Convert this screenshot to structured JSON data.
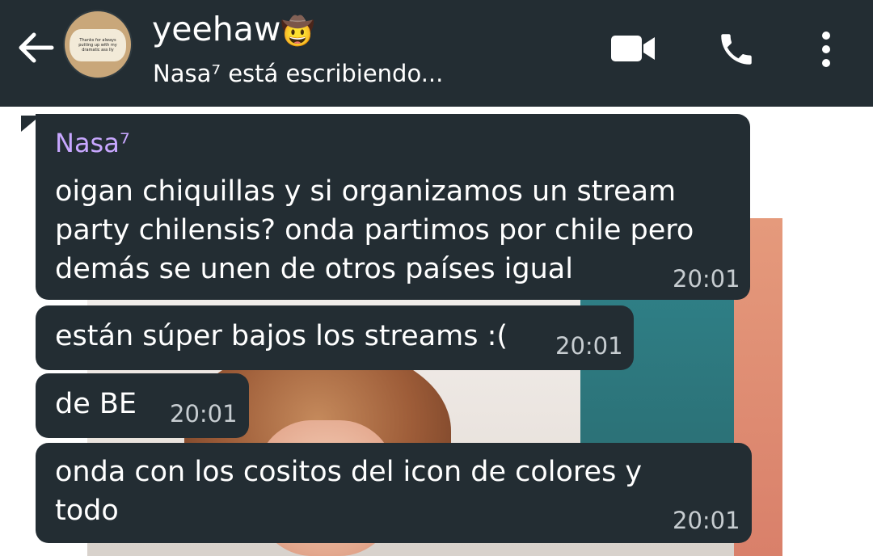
{
  "header": {
    "title": "yeehaw",
    "title_emoji": "🤠",
    "status": "Nasa⁷ está escribiendo...",
    "avatar_caption": "Thanks for always putting up with my dramatic ass lly",
    "icons": {
      "back": "arrow-back-icon",
      "video": "video-call-icon",
      "phone": "phone-call-icon",
      "more": "more-vert-icon"
    }
  },
  "messages": [
    {
      "sender": "Nasa⁷",
      "lines": [
        "oigan chiquillas y si organizamos un stream",
        "party chilensis? onda partimos por chile pero",
        "demás se unen de otros países igual"
      ],
      "time": "20:01"
    },
    {
      "lines": [
        "están súper bajos los streams :("
      ],
      "time": "20:01"
    },
    {
      "lines": [
        "de BE"
      ],
      "time": "20:01"
    },
    {
      "lines": [
        "onda con los cositos del icon de colores y",
        "todo"
      ],
      "time": "20:01"
    }
  ],
  "colors": {
    "header_bg": "#232d33",
    "bubble_bg": "#232d33",
    "sender_name": "#c8a7ff",
    "timestamp": "#c7cdd1"
  }
}
